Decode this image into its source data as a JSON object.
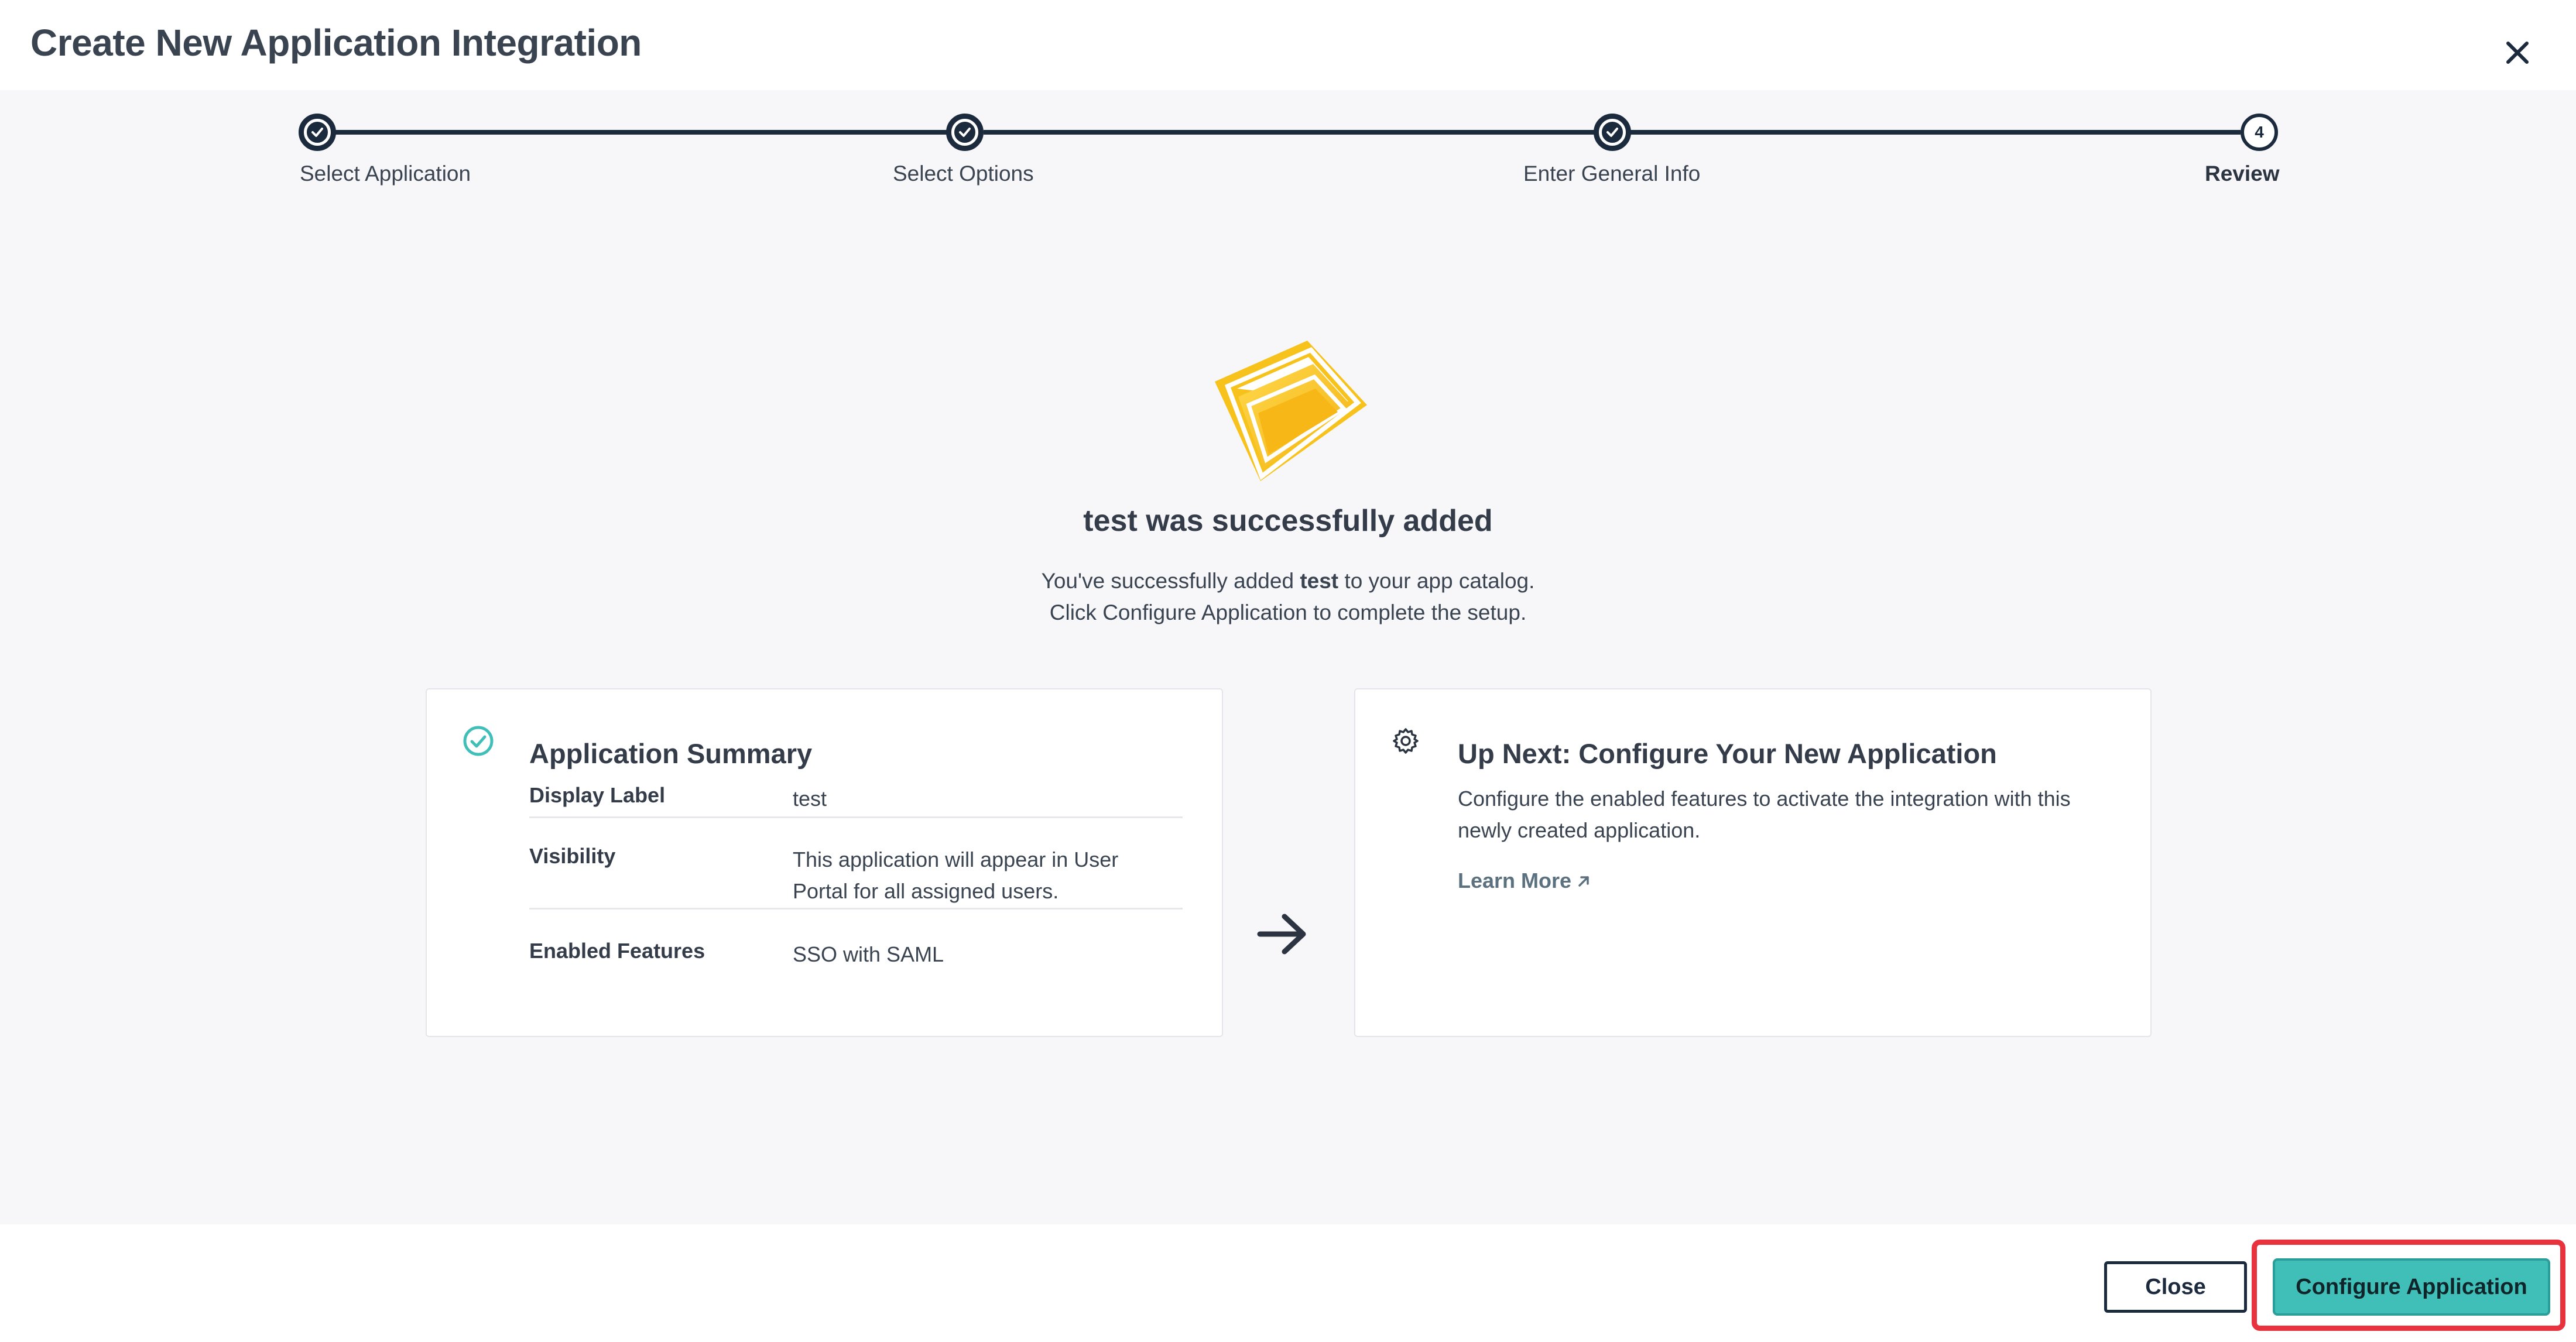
{
  "modal": {
    "title": "Create New Application Integration"
  },
  "stepper": {
    "steps": [
      {
        "label": "Select Application",
        "status": "complete"
      },
      {
        "label": "Select Options",
        "status": "complete"
      },
      {
        "label": "Enter General Info",
        "status": "complete"
      },
      {
        "label": "Review",
        "status": "current",
        "number": "4"
      }
    ]
  },
  "success": {
    "title": "test was successfully added",
    "line1_prefix": "You've successfully added ",
    "line1_app": "test",
    "line1_suffix": " to your app catalog.",
    "line2": "Click Configure Application to complete the setup."
  },
  "summary": {
    "title": "Application Summary",
    "rows": [
      {
        "label": "Display Label",
        "value": "test"
      },
      {
        "label": "Visibility",
        "value": "This application will appear in User Portal for all assigned users."
      },
      {
        "label": "Enabled Features",
        "value": "SSO with SAML"
      }
    ]
  },
  "next": {
    "title": "Up Next: Configure Your New Application",
    "description": "Configure the enabled features to activate the integration with this newly created application.",
    "learn_more": "Learn More"
  },
  "footer": {
    "close_label": "Close",
    "configure_label": "Configure Application"
  },
  "colors": {
    "primary_dark": "#1b2a3d",
    "accent_teal": "#3fbfb8",
    "highlight_red": "#e8333f",
    "success_yellow": "#f7c21c"
  }
}
